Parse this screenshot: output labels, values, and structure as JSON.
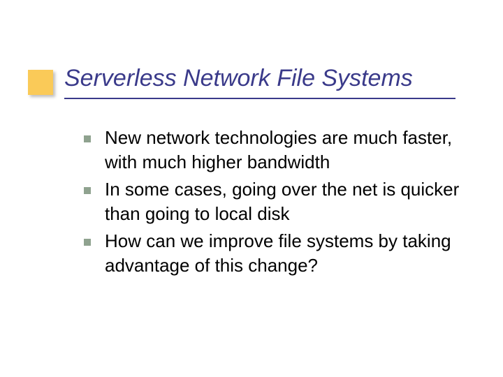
{
  "slide": {
    "title": "Serverless Network File Systems",
    "bullets": [
      "New network technologies are much faster, with much higher bandwidth",
      "In some cases, going over the net is quicker than going to local disk",
      "How can we improve file systems by taking advantage of this change?"
    ]
  }
}
